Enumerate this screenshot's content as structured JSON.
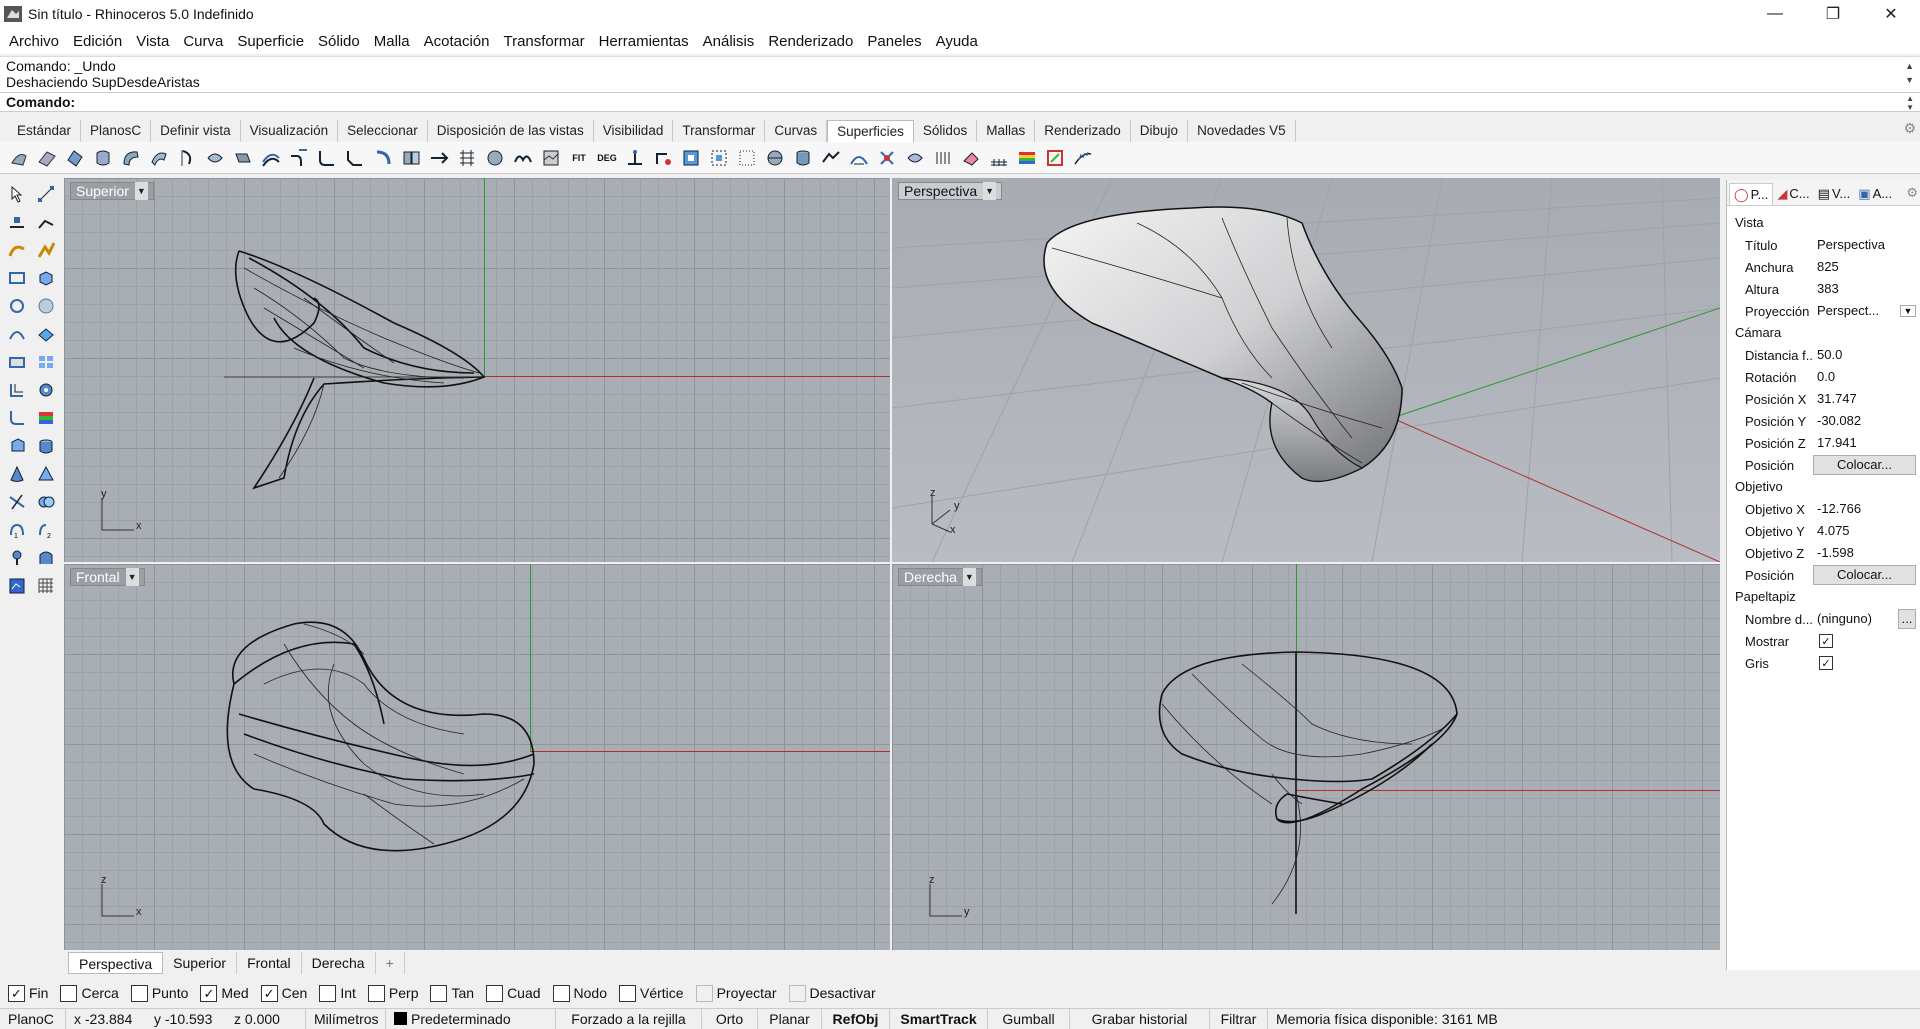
{
  "window": {
    "title": "Sin título - Rhinoceros 5.0 Indefinido",
    "minimize_icon": "minimize-icon",
    "maximize_icon": "restore-icon",
    "close_icon": "close-icon"
  },
  "menu": [
    "Archivo",
    "Edición",
    "Vista",
    "Curva",
    "Superficie",
    "Sólido",
    "Malla",
    "Acotación",
    "Transformar",
    "Herramientas",
    "Análisis",
    "Renderizado",
    "Paneles",
    "Ayuda"
  ],
  "command": {
    "history": [
      "Comando: _Undo",
      "Deshaciendo SupDesdeAristas"
    ],
    "prompt": "Comando:"
  },
  "toolbar_tabs": [
    "Estándar",
    "PlanosC",
    "Definir vista",
    "Visualización",
    "Seleccionar",
    "Disposición de las vistas",
    "Visibilidad",
    "Transformar",
    "Curvas",
    "Superficies",
    "Sólidos",
    "Mallas",
    "Renderizado",
    "Dibujo",
    "Novedades V5"
  ],
  "active_toolbar_tab": "Superficies",
  "viewports": {
    "top": {
      "label": "Superior",
      "axis_x": "x",
      "axis_y": "y"
    },
    "perspective": {
      "label": "Perspectiva",
      "axis_x": "x",
      "axis_y": "y",
      "axis_z": "z"
    },
    "front": {
      "label": "Frontal",
      "axis_x": "x",
      "axis_y": "z"
    },
    "right": {
      "label": "Derecha",
      "axis_x": "y",
      "axis_y": "z"
    }
  },
  "view_tabs": [
    "Perspectiva",
    "Superior",
    "Frontal",
    "Derecha"
  ],
  "view_tab_add": "+",
  "osnaps": [
    {
      "label": "Fin",
      "checked": true
    },
    {
      "label": "Cerca",
      "checked": false
    },
    {
      "label": "Punto",
      "checked": false
    },
    {
      "label": "Med",
      "checked": true
    },
    {
      "label": "Cen",
      "checked": true
    },
    {
      "label": "Int",
      "checked": false
    },
    {
      "label": "Perp",
      "checked": false
    },
    {
      "label": "Tan",
      "checked": false
    },
    {
      "label": "Cuad",
      "checked": false
    },
    {
      "label": "Nodo",
      "checked": false
    },
    {
      "label": "Vértice",
      "checked": false
    },
    {
      "label": "Proyectar",
      "checked": false,
      "disabled": true
    },
    {
      "label": "Desactivar",
      "checked": false,
      "disabled": true
    }
  ],
  "status": {
    "cplane": "PlanoC",
    "x": "x -23.884",
    "y": "y -10.593",
    "z": "z 0.000",
    "units": "Milímetros",
    "layer": "Predeterminado",
    "grid_snap": "Forzado a la rejilla",
    "ortho": "Orto",
    "planar": "Planar",
    "osnap": "RefObj",
    "smarttrack": "SmartTrack",
    "gumball": "Gumball",
    "history": "Grabar historial",
    "filter": "Filtrar",
    "memory": "Memoria física disponible: 3161 MB"
  },
  "panel": {
    "tabs": [
      "P...",
      "C...",
      "V...",
      "A..."
    ],
    "sections": {
      "view": {
        "heading": "Vista",
        "rows": [
          {
            "label": "Título",
            "value": "Perspectiva"
          },
          {
            "label": "Anchura",
            "value": "825"
          },
          {
            "label": "Altura",
            "value": "383"
          },
          {
            "label": "Proyección",
            "value": "Perspect..."
          }
        ]
      },
      "camera": {
        "heading": "Cámara",
        "rows": [
          {
            "label": "Distancia f...",
            "value": "50.0"
          },
          {
            "label": "Rotación",
            "value": "0.0"
          },
          {
            "label": "Posición X",
            "value": "31.747"
          },
          {
            "label": "Posición Y",
            "value": "-30.082"
          },
          {
            "label": "Posición Z",
            "value": "17.941"
          }
        ],
        "position_label": "Posición",
        "position_button": "Colocar..."
      },
      "target": {
        "heading": "Objetivo",
        "rows": [
          {
            "label": "Objetivo X",
            "value": "-12.766"
          },
          {
            "label": "Objetivo Y",
            "value": "4.075"
          },
          {
            "label": "Objetivo Z",
            "value": "-1.598"
          }
        ],
        "position_label": "Posición",
        "position_button": "Colocar..."
      },
      "wallpaper": {
        "heading": "Papeltapiz",
        "filename_label": "Nombre d...",
        "filename_value": "(ninguno)",
        "browse_button": "...",
        "show_label": "Mostrar",
        "gray_label": "Gris"
      }
    }
  },
  "colors": {
    "viewport_bg": "#a9adb4",
    "x_axis": "#b03030",
    "y_axis": "#30a030",
    "curve": "#111111"
  }
}
